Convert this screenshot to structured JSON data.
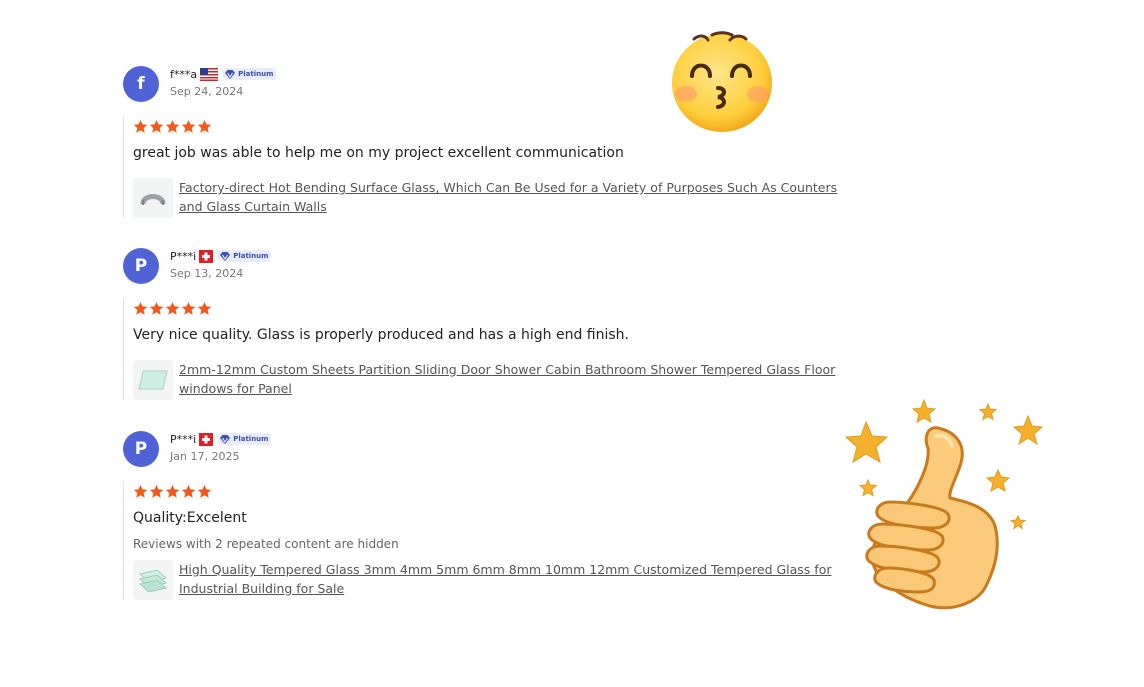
{
  "badge_label": "Platinum",
  "icons": {
    "rating": "star-icon",
    "badge": "diamond-icon",
    "emoji": "kissing-face-icon",
    "sticker": "thumbs-up-icon"
  },
  "colors": {
    "star": "#f05a1a",
    "avatar": "#4f63d6",
    "badge_bg": "#e8ecfb"
  },
  "reviews": [
    {
      "avatar_letter": "f",
      "user": "f***a",
      "flag": "US",
      "date": "Sep 24, 2024",
      "rating": 5,
      "content": "great job was able to help me on my project excellent communication",
      "product": "Factory-direct Hot Bending Surface Glass, Which Can Be Used for a Variety of Purposes Such As Counters and Glass Curtain Walls"
    },
    {
      "avatar_letter": "P",
      "user": "P***i",
      "flag": "CH",
      "date": "Sep 13, 2024",
      "rating": 5,
      "content": "Very nice quality. Glass is properly produced and has a high end finish.",
      "product": "2mm-12mm Custom Sheets Partition Sliding Door Shower Cabin Bathroom Shower Tempered Glass Floor windows for Panel"
    },
    {
      "avatar_letter": "P",
      "user": "P***i",
      "flag": "CH",
      "date": "Jan 17, 2025",
      "rating": 5,
      "content": "Quality:Excelent",
      "note": "Reviews with 2 repeated content are hidden",
      "product": "High Quality Tempered Glass 3mm 4mm 5mm 6mm 8mm 10mm 12mm Customized Tempered Glass for Industrial Building for Sale"
    }
  ]
}
